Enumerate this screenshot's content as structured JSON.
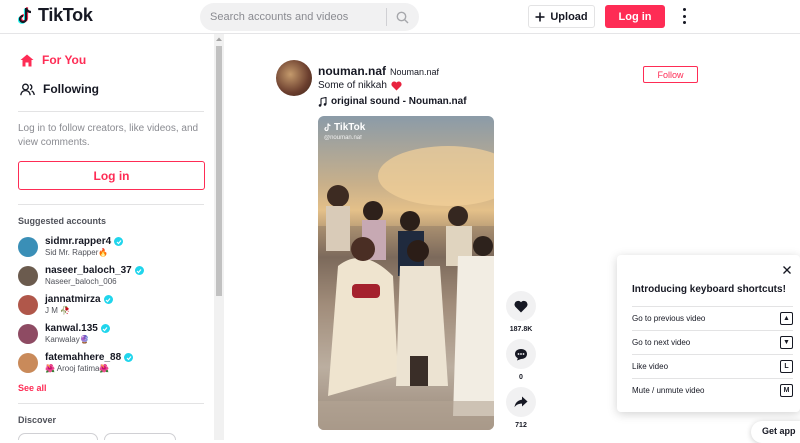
{
  "header": {
    "brand": "TikTok",
    "search_placeholder": "Search accounts and videos",
    "upload_label": "Upload",
    "login_label": "Log in"
  },
  "sidebar": {
    "nav": [
      {
        "label": "For You",
        "icon": "home-icon",
        "active": true
      },
      {
        "label": "Following",
        "icon": "users-icon",
        "active": false
      }
    ],
    "login_hint": "Log in to follow creators, like videos, and view comments.",
    "login_label": "Log in",
    "suggested_title": "Suggested accounts",
    "accounts": [
      {
        "username": "sidmr.rapper4",
        "subtitle": "Sid Mr. Rapper🔥",
        "verified": true,
        "color": "#3a8fb7"
      },
      {
        "username": "naseer_baloch_37",
        "subtitle": "Naseer_baloch_006",
        "verified": true,
        "color": "#6b5b4e"
      },
      {
        "username": "jannatmirza",
        "subtitle": "J M 🥀",
        "verified": true,
        "color": "#b0574a"
      },
      {
        "username": "kanwal.135",
        "subtitle": "Kanwalay🔮",
        "verified": true,
        "color": "#8e4b63"
      },
      {
        "username": "fatemahhere_88",
        "subtitle": "🌺 Arooj fatima🌺",
        "verified": true,
        "color": "#c98a5a"
      }
    ],
    "see_all": "See all",
    "discover_title": "Discover"
  },
  "post": {
    "username": "nouman.naf",
    "nickname": "Nouman.naf",
    "caption": "Some of nikkah",
    "caption_emoji": "❤️",
    "music": "original sound - Nouman.naf",
    "follow_label": "Follow",
    "watermark_brand": "TikTok",
    "watermark_handle": "@nouman.naf",
    "likes": "187.8K",
    "comments": "0",
    "shares": "712"
  },
  "keyboard_popup": {
    "title": "Introducing keyboard shortcuts!",
    "shortcuts": [
      {
        "label": "Go to previous video",
        "key": "▲"
      },
      {
        "label": "Go to next video",
        "key": "▼"
      },
      {
        "label": "Like video",
        "key": "L"
      },
      {
        "label": "Mute / unmute video",
        "key": "M"
      }
    ]
  },
  "get_app": "Get app",
  "colors": {
    "brand": "#fe2c55",
    "verified": "#20d5ec",
    "text": "#161823"
  }
}
